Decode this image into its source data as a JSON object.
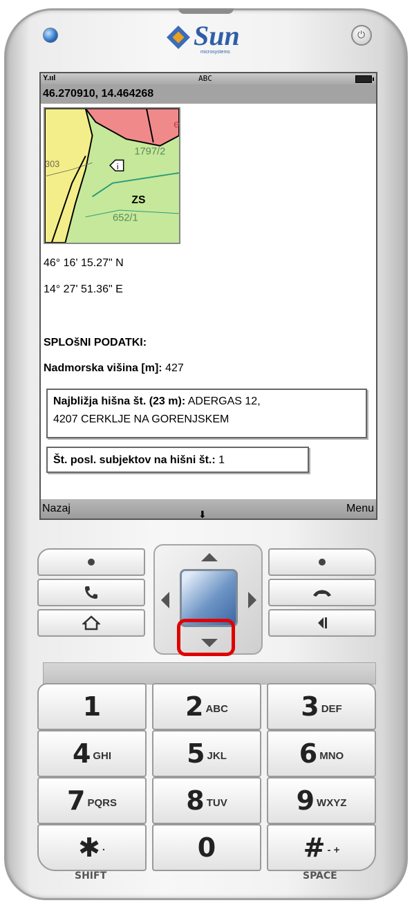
{
  "status": {
    "signal": "Y.ııl",
    "input_mode": "ABC"
  },
  "coordinates_header": "46.270910, 14.464268",
  "map": {
    "labels": [
      "1797/2",
      "652/1",
      "ZS",
      "303",
      "e"
    ],
    "info_marker": "i"
  },
  "latitude_dms": "46° 16' 15.27\" N",
  "longitude_dms": "14° 27' 51.36\" E",
  "section_heading": "SPLOšNI PODATKI:",
  "altitude": {
    "label": "Nadmorska višina [m]:",
    "value": "427"
  },
  "nearest_house": {
    "label": "Najbližja hišna št. (23 m):",
    "value_line1": "ADERGAS 12,",
    "value_line2": "4207 CERKLJE NA GORENJSKEM"
  },
  "subjects": {
    "label": "Št. posl. subjektov na hišni št.:",
    "value": "1"
  },
  "softkeys": {
    "left": "Nazaj",
    "right": "Menu",
    "center": "⬇"
  },
  "keypad": [
    {
      "n": "1",
      "l": ""
    },
    {
      "n": "2",
      "l": "ABC"
    },
    {
      "n": "3",
      "l": "DEF"
    },
    {
      "n": "4",
      "l": "GHI"
    },
    {
      "n": "5",
      "l": "JKL"
    },
    {
      "n": "6",
      "l": "MNO"
    },
    {
      "n": "7",
      "l": "PQRS"
    },
    {
      "n": "8",
      "l": "TUV"
    },
    {
      "n": "9",
      "l": "WXYZ"
    },
    {
      "n": "✱",
      "l": "·"
    },
    {
      "n": "0",
      "l": ""
    },
    {
      "n": "#",
      "l": "- +"
    }
  ],
  "bottom_labels": {
    "left": "SHIFT",
    "right": "SPACE"
  },
  "logo": {
    "word": "Sun",
    "sub": "microsystems"
  },
  "colors": {
    "highlight": "#e00000",
    "statusbar": "#a3a3a3",
    "map_green": "#c6e89a",
    "map_yellow": "#f4ee8a",
    "map_red": "#f08a8a"
  }
}
